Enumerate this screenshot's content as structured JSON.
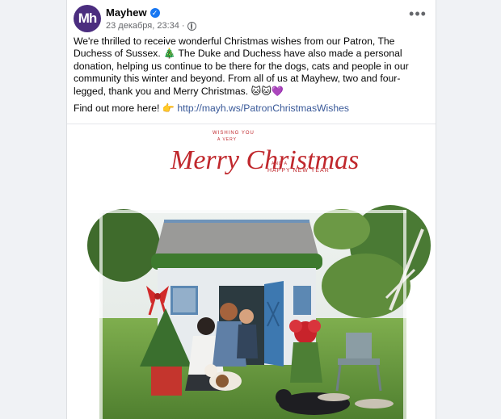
{
  "post": {
    "avatar_text": "Mh",
    "page_name": "Mayhew",
    "date": "23 декабря, 23:34",
    "separator": "·",
    "more_label": "•••",
    "text_line1_a": "We're thrilled to receive wonderful Christmas wishes from our Patron, The Duchess of Sussex.",
    "tree_emoji": "🎄",
    "text_line1_b": "The Duke and Duchess have also made a personal donation, helping us continue to be there for the dogs, cats and people in our community this winter and beyond. From all of us at Mayhew, two and four-legged, thank you and Merry Christmas.",
    "emoji_trail": "🐱🐱💜",
    "find_out": "Find out more here!",
    "point_emoji": "👉",
    "link": "http://mayh.ws/PatronChristmasWishes"
  },
  "card": {
    "wishing": "WISHING YOU",
    "a_very": "A VERY",
    "merry_christmas": "Merry Christmas",
    "and_a": "AND A",
    "happy_new_year": "HAPPY NEW YEAR"
  },
  "colors": {
    "brand_purple": "#4b2d7f",
    "card_red": "#c0282d",
    "link_blue": "#385898",
    "verified_blue": "#1877f2"
  },
  "icons": {
    "verified": "verified-badge-icon",
    "globe": "globe-icon",
    "more": "more-options-icon"
  }
}
